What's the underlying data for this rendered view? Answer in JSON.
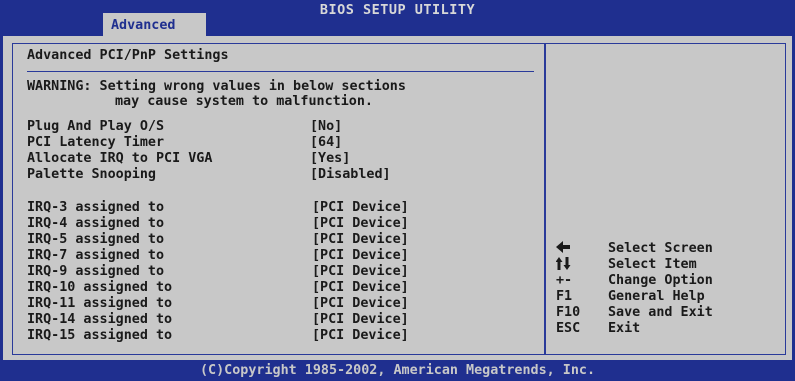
{
  "header": {
    "title": "BIOS SETUP UTILITY",
    "active_tab": "Advanced"
  },
  "panel": {
    "heading": "Advanced PCI/PnP Settings",
    "warning_line1": "WARNING: Setting wrong values in below sections",
    "warning_line2": "may cause system to malfunction."
  },
  "settings": [
    {
      "label": "Plug And Play O/S",
      "value": "[No]"
    },
    {
      "label": "PCI Latency Timer",
      "value": "[64]"
    },
    {
      "label": "Allocate IRQ to PCI VGA",
      "value": "[Yes]"
    },
    {
      "label": "Palette Snooping",
      "value": "[Disabled]"
    }
  ],
  "irqs": [
    {
      "label": "IRQ-3 assigned to",
      "value": "[PCI Device]"
    },
    {
      "label": "IRQ-4 assigned to",
      "value": "[PCI Device]"
    },
    {
      "label": "IRQ-5 assigned to",
      "value": "[PCI Device]"
    },
    {
      "label": "IRQ-7 assigned to",
      "value": "[PCI Device]"
    },
    {
      "label": "IRQ-9 assigned to",
      "value": "[PCI Device]"
    },
    {
      "label": "IRQ-10 assigned to",
      "value": "[PCI Device]"
    },
    {
      "label": "IRQ-11 assigned to",
      "value": "[PCI Device]"
    },
    {
      "label": "IRQ-14 assigned to",
      "value": "[PCI Device]"
    },
    {
      "label": "IRQ-15 assigned to",
      "value": "[PCI Device]"
    }
  ],
  "help": [
    {
      "key": "",
      "icon": "left-arrow-icon",
      "desc": "Select Screen"
    },
    {
      "key": "",
      "icon": "up-down-arrow-icon",
      "desc": "Select Item"
    },
    {
      "key": "+-",
      "desc": "Change Option"
    },
    {
      "key": "F1",
      "desc": "General Help"
    },
    {
      "key": "F10",
      "desc": "Save and Exit"
    },
    {
      "key": "ESC",
      "desc": "Exit"
    }
  ],
  "footer": {
    "copyright": "(C)Copyright 1985-2002, American Megatrends, Inc."
  }
}
